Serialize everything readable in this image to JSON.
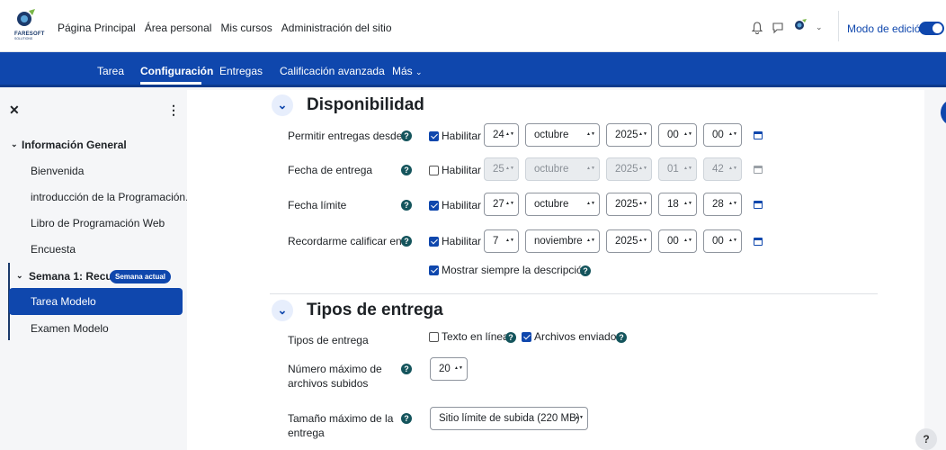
{
  "brand": {
    "name": "FARESOFT",
    "sub": "SOLUTIONS"
  },
  "topnav": [
    "Página Principal",
    "Área personal",
    "Mis cursos",
    "Administración del sitio"
  ],
  "edit_mode_label": "Modo de edición",
  "subnav": [
    "Tarea",
    "Configuración",
    "Entregas",
    "Calificación avanzada",
    "Más"
  ],
  "sidebar": {
    "sections": [
      {
        "title": "Información General",
        "items": [
          "Bienvenida",
          "introducción de la Programación...",
          "Libro de Programación Web",
          "Encuesta"
        ]
      },
      {
        "title": "Semana 1: Recur...",
        "badge": "Semana actual",
        "items": [
          "Tarea Modelo",
          "Examen Modelo"
        ],
        "active": "Tarea Modelo"
      }
    ]
  },
  "availability": {
    "title": "Disponibilidad",
    "enable_label": "Habilitar",
    "rows": [
      {
        "label": "Permitir entregas desde",
        "enabled": true,
        "day": "24",
        "month": "octubre",
        "year": "2025",
        "hour": "00",
        "minute": "00"
      },
      {
        "label": "Fecha de entrega",
        "enabled": false,
        "day": "25",
        "month": "octubre",
        "year": "2025",
        "hour": "01",
        "minute": "42"
      },
      {
        "label": "Fecha límite",
        "enabled": true,
        "day": "27",
        "month": "octubre",
        "year": "2025",
        "hour": "18",
        "minute": "28"
      },
      {
        "label": "Recordarme calificar en",
        "enabled": true,
        "day": "7",
        "month": "noviembre",
        "year": "2025",
        "hour": "00",
        "minute": "00"
      }
    ],
    "always_show_description": "Mostrar siempre la descripción"
  },
  "submission_types": {
    "title": "Tipos de entrega",
    "types_label": "Tipos de entrega",
    "online_text": "Texto en línea",
    "online_text_checked": false,
    "file_submissions": "Archivos enviados",
    "file_submissions_checked": true,
    "max_files_label_1": "Número máximo de",
    "max_files_label_2": "archivos subidos",
    "max_files_value": "20",
    "max_size_label_1": "Tamaño máximo de la",
    "max_size_label_2": "entrega",
    "max_size_value": "Sitio límite de subida (220 MB)"
  },
  "help_button": "?"
}
